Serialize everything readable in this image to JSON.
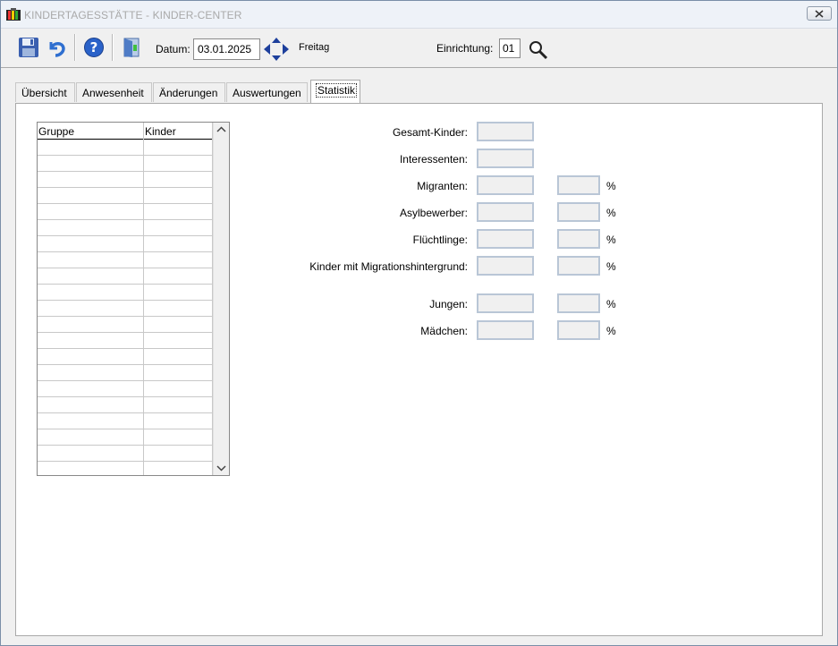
{
  "window": {
    "title": "KINDERTAGESSTÄTTE - KINDER-CENTER"
  },
  "toolbar": {
    "icons": [
      "save-icon",
      "undo-icon",
      "help-icon",
      "exit-door-icon",
      "navigate-arrows-icon",
      "search-icon"
    ],
    "date_label": "Datum:",
    "date_value": "03.01.2025",
    "weekday": "Freitag",
    "facility_label": "Einrichtung:",
    "facility_value": "01"
  },
  "tabs": [
    {
      "label": "Übersicht",
      "active": false
    },
    {
      "label": "Anwesenheit",
      "active": false
    },
    {
      "label": "Änderungen",
      "active": false
    },
    {
      "label": "Auswertungen",
      "active": false
    },
    {
      "label": "Statistik",
      "active": true
    }
  ],
  "group_table": {
    "columns": [
      "Gruppe",
      "Kinder"
    ],
    "rows": []
  },
  "statistics": {
    "total_children": {
      "label": "Gesamt-Kinder:",
      "value": ""
    },
    "prospects": {
      "label": "Interessenten:",
      "value": ""
    },
    "migrants": {
      "label": "Migranten:",
      "value": "",
      "percent": "",
      "unit": "%"
    },
    "asylum_seekers": {
      "label": "Asylbewerber:",
      "value": "",
      "percent": "",
      "unit": "%"
    },
    "refugees": {
      "label": "Flüchtlinge:",
      "value": "",
      "percent": "",
      "unit": "%"
    },
    "migration_background": {
      "label": "Kinder mit Migrationshintergrund:",
      "value": "",
      "percent": "",
      "unit": "%"
    },
    "boys": {
      "label": "Jungen:",
      "value": "",
      "percent": "",
      "unit": "%"
    },
    "girls": {
      "label": "Mädchen:",
      "value": "",
      "percent": "",
      "unit": "%"
    }
  },
  "colors": {
    "save_icon": "#3a5fb0",
    "undo_icon": "#2f6fd0",
    "help_icon": "#2a62c9",
    "navigate_arrows": "#1d3f9c",
    "field_border": "#b9c6d6",
    "readonly_field_bg": "#f0f0f0"
  }
}
